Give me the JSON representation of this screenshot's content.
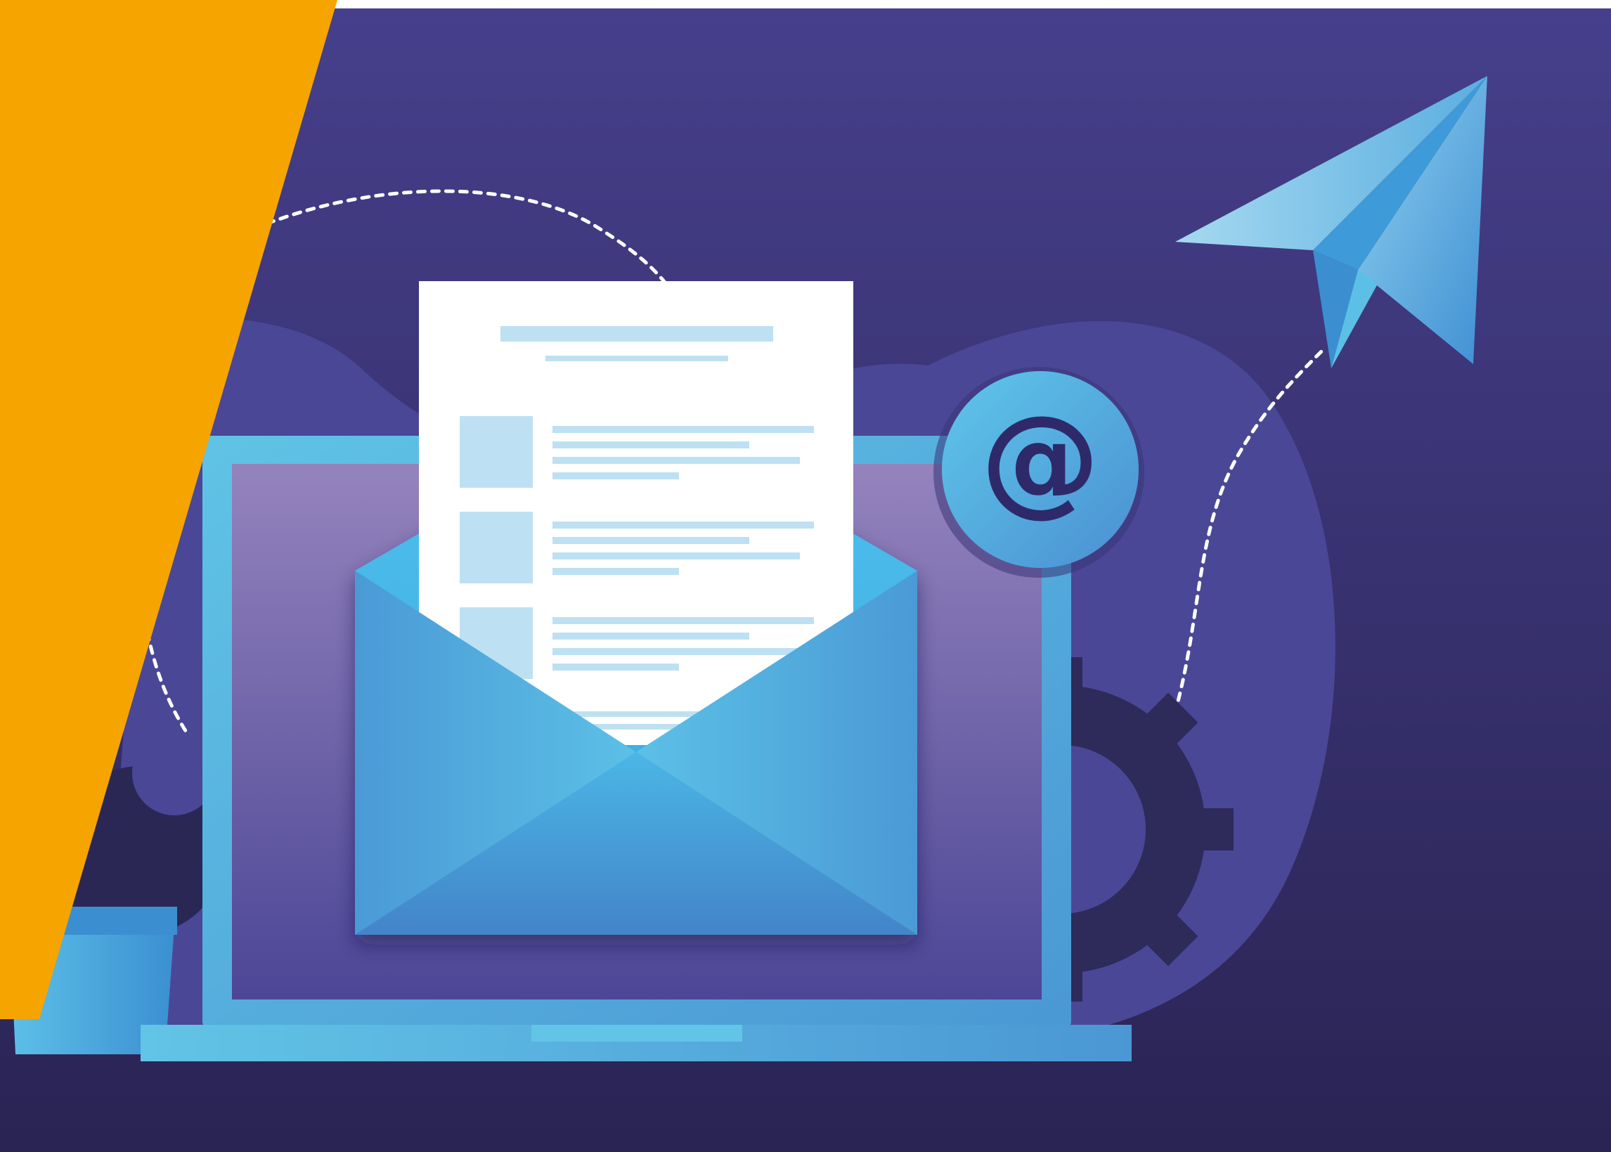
{
  "illustration": {
    "icons": {
      "at_symbol": "@",
      "at_badge_icon": "at-sign-icon",
      "envelope_icon": "envelope-icon",
      "paper_plane_icon": "paper-plane-icon",
      "gear_icon": "gear-icon",
      "laptop_icon": "laptop-icon",
      "document_icon": "document-icon"
    },
    "colors": {
      "background_top": "#463f8b",
      "background_bottom": "#2a2454",
      "orange_accent": "#f6a400",
      "blob": "#4b4797",
      "laptop_frame": "#5ab8e0",
      "envelope": "#4aa0d8",
      "paper": "#ffffff",
      "paper_lines": "#bde1f2",
      "gear": "#2e2a5a"
    }
  }
}
